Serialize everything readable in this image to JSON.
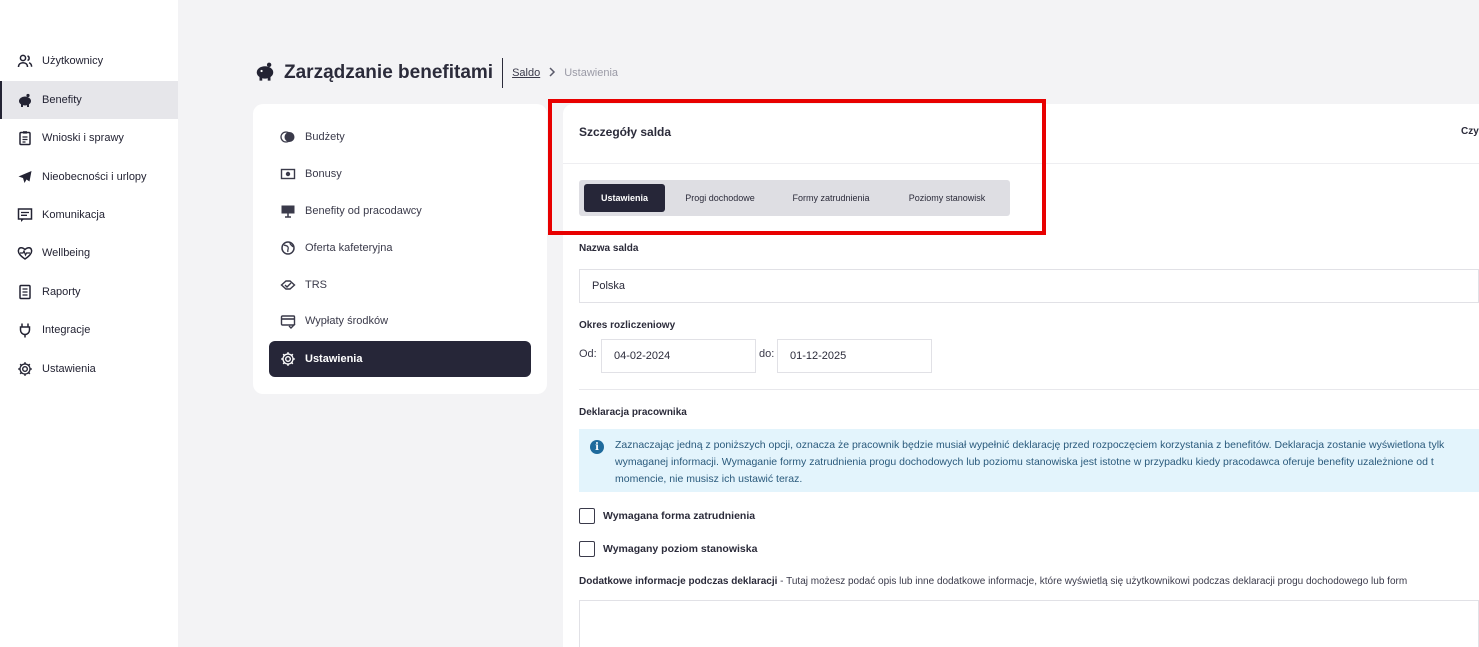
{
  "nav": {
    "items": [
      {
        "label": "Użytkownicy",
        "icon": "users-icon"
      },
      {
        "label": "Benefity",
        "icon": "piggy-bank-icon"
      },
      {
        "label": "Wnioski i sprawy",
        "icon": "clipboard-icon"
      },
      {
        "label": "Nieobecności i urlopy",
        "icon": "airplane-icon"
      },
      {
        "label": "Komunikacja",
        "icon": "message-icon"
      },
      {
        "label": "Wellbeing",
        "icon": "heart-pulse-icon"
      },
      {
        "label": "Raporty",
        "icon": "report-icon"
      },
      {
        "label": "Integracje",
        "icon": "plug-icon"
      },
      {
        "label": "Ustawienia",
        "icon": "gear-icon"
      }
    ],
    "active_index": 1
  },
  "header": {
    "title": "Zarządzanie benefitami",
    "breadcrumb_link": "Saldo",
    "breadcrumb_current": "Ustawienia"
  },
  "settings_menu": {
    "items": [
      {
        "label": "Budżety",
        "icon": "budget-icon"
      },
      {
        "label": "Bonusy",
        "icon": "bonus-icon"
      },
      {
        "label": "Benefity od pracodawcy",
        "icon": "monitor-icon"
      },
      {
        "label": "Oferta kafeteryjna",
        "icon": "globe-icon"
      },
      {
        "label": "TRS",
        "icon": "trs-icon"
      },
      {
        "label": "Wypłaty środków",
        "icon": "payout-icon"
      },
      {
        "label": "Ustawienia",
        "icon": "gear-icon"
      }
    ],
    "active_index": 6
  },
  "panel": {
    "title": "Szczegóły salda",
    "right_text": "Czy",
    "tabs": [
      "Ustawienia",
      "Progi dochodowe",
      "Formy zatrudnienia",
      "Poziomy stanowisk"
    ],
    "active_tab": 0,
    "balance_name_label": "Nazwa salda",
    "balance_name_value": "Polska",
    "period_label": "Okres rozliczeniowy",
    "from_label": "Od:",
    "from_value": "04-02-2024",
    "to_label": "do:",
    "to_value": "01-12-2025",
    "declaration_label": "Deklaracja pracownika",
    "info_lines": [
      "Zaznaczając jedną z poniższych opcji, oznacza że pracownik będzie musiał wypełnić deklarację przed rozpoczęciem korzystania z benefitów. Deklaracja zostanie wyświetlona tylk",
      "wymaganej informacji. Wymaganie formy zatrudnienia progu dochodowych lub poziomu stanowiska jest istotne w przypadku kiedy pracodawca oferuje benefity uzależnione od t",
      "momencie, nie musisz ich ustawić teraz."
    ],
    "checkbox_employment": "Wymagana forma zatrudnienia",
    "checkbox_position": "Wymagany poziom stanowiska",
    "extra_info_label": "Dodatkowe informacje podczas deklaracji",
    "extra_info_text": " - Tutaj możesz podać opis lub inne dodatkowe informacje, które wyświetlą się użytkownikowi podczas deklaracji progu dochodowego lub form"
  },
  "colors": {
    "accent_dark": "#262638",
    "highlight": "#e80000",
    "info_bg": "#e3f4fc"
  }
}
